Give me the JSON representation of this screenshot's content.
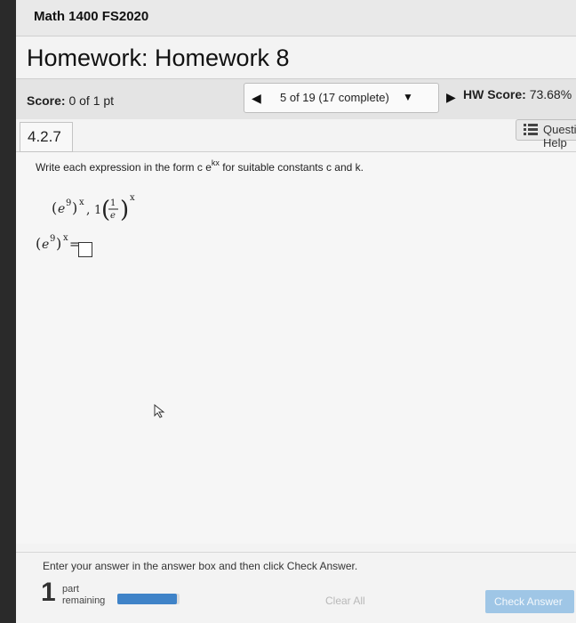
{
  "course": {
    "title": "Math 1400 FS2020"
  },
  "homework": {
    "title": "Homework: Homework 8"
  },
  "score": {
    "label": "Score:",
    "value": "0 of 1 pt"
  },
  "navigation": {
    "position_text": "5 of 19 (17 complete)"
  },
  "hw_score": {
    "label": "HW Score:",
    "value": "73.68%"
  },
  "question": {
    "number": "4.2.7",
    "help_label": "Question Help",
    "instruction_pre": "Write each expression in the form c e",
    "instruction_sup": "kx",
    "instruction_post": " for suitable constants c and k."
  },
  "footer": {
    "message": "Enter your answer in the answer box and then click Check Answer.",
    "parts_count": "1",
    "parts_label_1": "part",
    "parts_label_2": "remaining",
    "progress_fraction": 0.95,
    "clear_all_label": "Clear All",
    "check_answer_label": "Check Answer"
  },
  "icons": [
    "prev-arrow-icon",
    "next-arrow-icon",
    "dropdown-caret-icon",
    "list-icon",
    "mouse-cursor-icon"
  ],
  "colors": {
    "progress": "#3f83c8",
    "check_button": "#9fc6e6"
  }
}
